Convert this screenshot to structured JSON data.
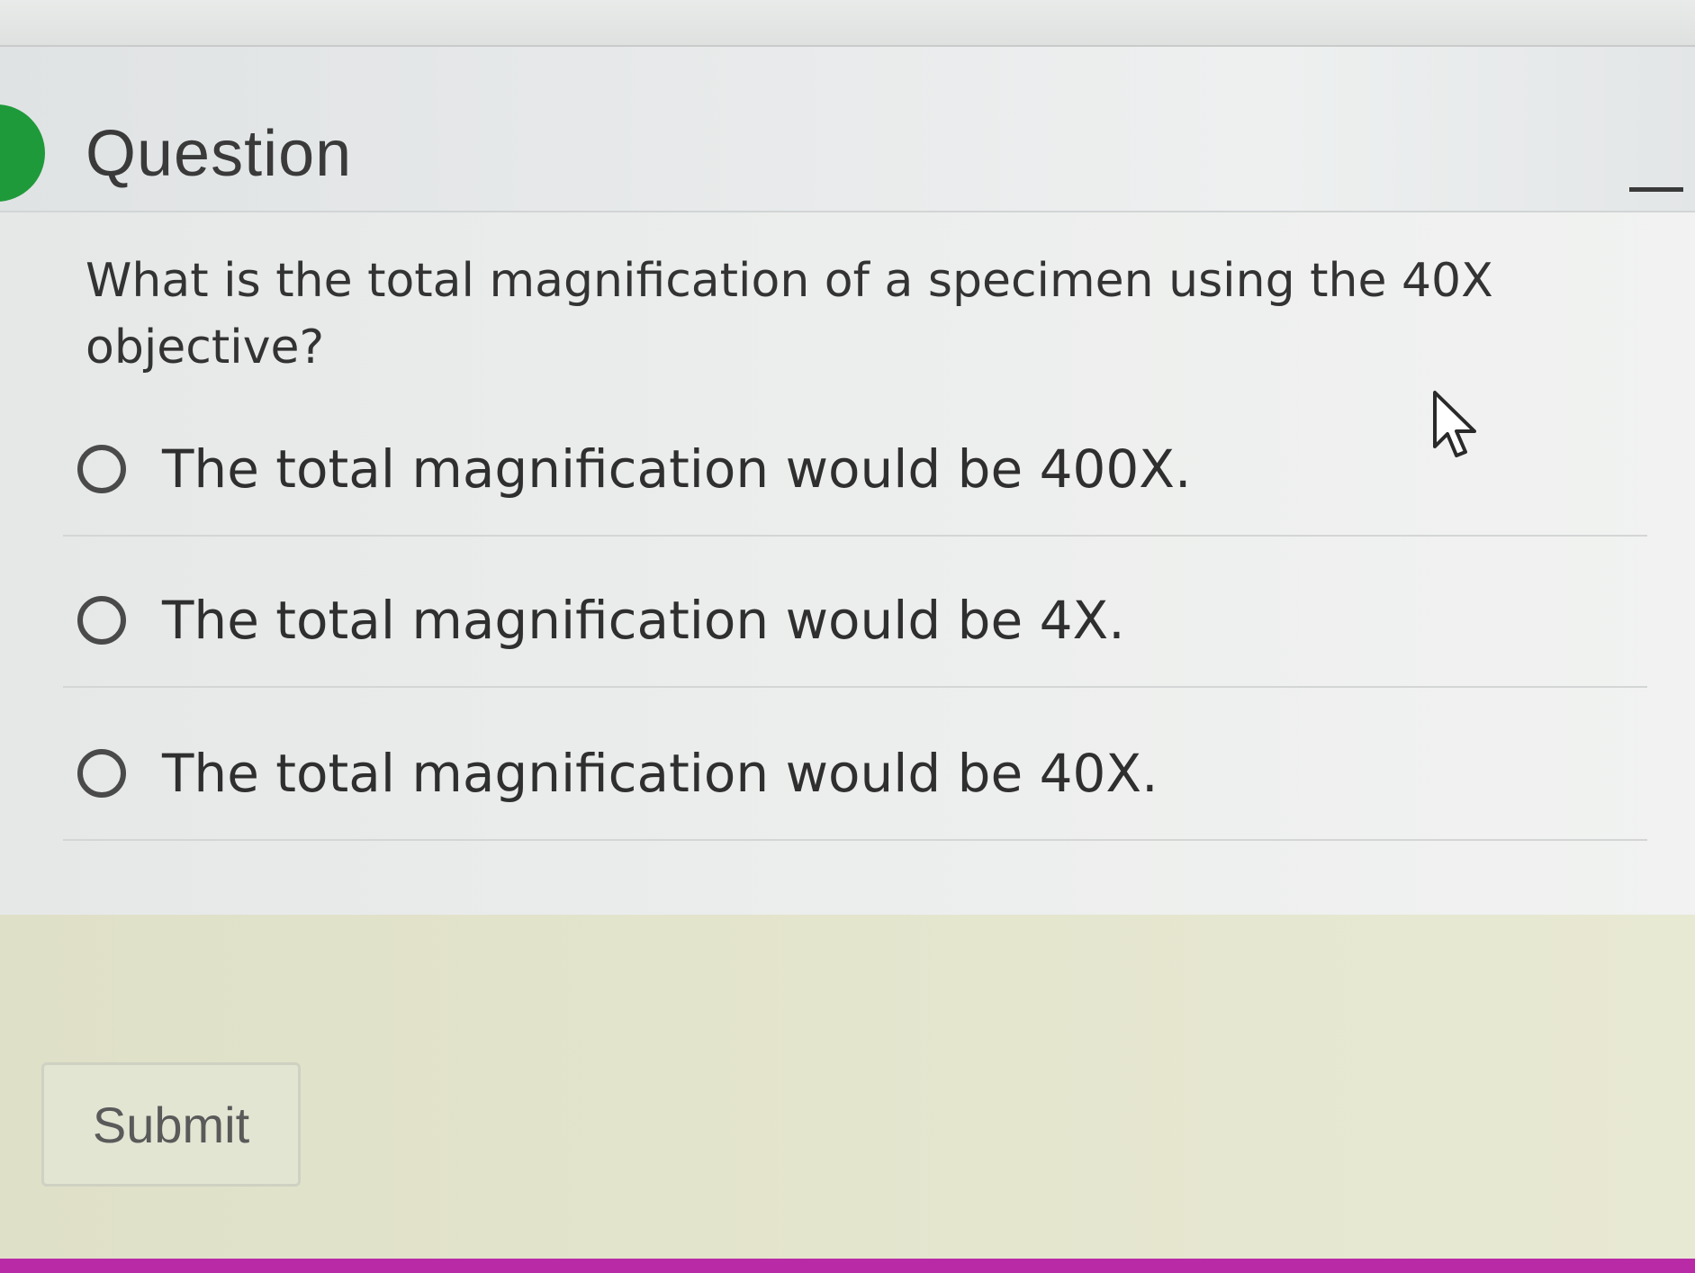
{
  "header": {
    "title": "Question"
  },
  "question": {
    "text": "What is the total magnification of a specimen using the 40X objective?"
  },
  "options": [
    {
      "label": "The total magnification would be 400X.",
      "selected": false
    },
    {
      "label": "The total magnification would be 4X.",
      "selected": false
    },
    {
      "label": "The total magnification would be 40X.",
      "selected": false
    }
  ],
  "footer": {
    "submit_label": "Submit"
  },
  "colors": {
    "status_green": "#1f9a3a",
    "bottom_bar": "#b82aa6"
  },
  "icons": {
    "minimize": "minimize-icon",
    "cursor": "mouse-pointer-icon"
  }
}
